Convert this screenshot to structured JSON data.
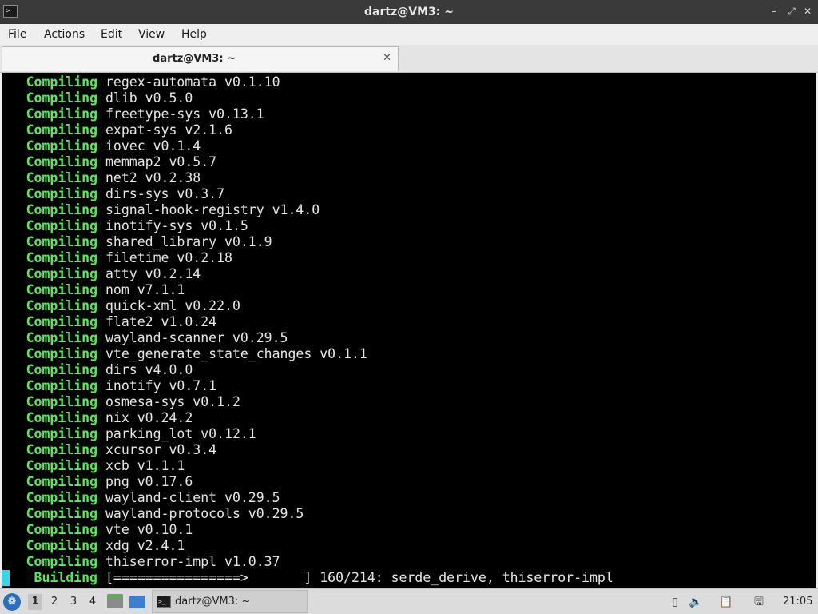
{
  "window": {
    "title": "dartz@VM3: ~",
    "icon": "terminal-icon",
    "controls": [
      "minimize-icon",
      "maximize-icon",
      "close-icon"
    ]
  },
  "menu": {
    "items": [
      "File",
      "Actions",
      "Edit",
      "View",
      "Help"
    ]
  },
  "tabs": [
    {
      "label": "dartz@VM3: ~",
      "close_icon": "close-icon"
    }
  ],
  "terminal": {
    "colors": {
      "keyword": "#55ec55",
      "text": "#e6e6e6",
      "background": "#000000",
      "cursor": "#39d5e0"
    },
    "lines": [
      {
        "keyword": "Compiling",
        "text": "regex-automata v0.1.10"
      },
      {
        "keyword": "Compiling",
        "text": "dlib v0.5.0"
      },
      {
        "keyword": "Compiling",
        "text": "freetype-sys v0.13.1"
      },
      {
        "keyword": "Compiling",
        "text": "expat-sys v2.1.6"
      },
      {
        "keyword": "Compiling",
        "text": "iovec v0.1.4"
      },
      {
        "keyword": "Compiling",
        "text": "memmap2 v0.5.7"
      },
      {
        "keyword": "Compiling",
        "text": "net2 v0.2.38"
      },
      {
        "keyword": "Compiling",
        "text": "dirs-sys v0.3.7"
      },
      {
        "keyword": "Compiling",
        "text": "signal-hook-registry v1.4.0"
      },
      {
        "keyword": "Compiling",
        "text": "inotify-sys v0.1.5"
      },
      {
        "keyword": "Compiling",
        "text": "shared_library v0.1.9"
      },
      {
        "keyword": "Compiling",
        "text": "filetime v0.2.18"
      },
      {
        "keyword": "Compiling",
        "text": "atty v0.2.14"
      },
      {
        "keyword": "Compiling",
        "text": "nom v7.1.1"
      },
      {
        "keyword": "Compiling",
        "text": "quick-xml v0.22.0"
      },
      {
        "keyword": "Compiling",
        "text": "flate2 v1.0.24"
      },
      {
        "keyword": "Compiling",
        "text": "wayland-scanner v0.29.5"
      },
      {
        "keyword": "Compiling",
        "text": "vte_generate_state_changes v0.1.1"
      },
      {
        "keyword": "Compiling",
        "text": "dirs v4.0.0"
      },
      {
        "keyword": "Compiling",
        "text": "inotify v0.7.1"
      },
      {
        "keyword": "Compiling",
        "text": "osmesa-sys v0.1.2"
      },
      {
        "keyword": "Compiling",
        "text": "nix v0.24.2"
      },
      {
        "keyword": "Compiling",
        "text": "parking_lot v0.12.1"
      },
      {
        "keyword": "Compiling",
        "text": "xcursor v0.3.4"
      },
      {
        "keyword": "Compiling",
        "text": "xcb v1.1.1"
      },
      {
        "keyword": "Compiling",
        "text": "png v0.17.6"
      },
      {
        "keyword": "Compiling",
        "text": "wayland-client v0.29.5"
      },
      {
        "keyword": "Compiling",
        "text": "wayland-protocols v0.29.5"
      },
      {
        "keyword": "Compiling",
        "text": "vte v0.10.1"
      },
      {
        "keyword": "Compiling",
        "text": "xdg v2.4.1"
      },
      {
        "keyword": "Compiling",
        "text": "thiserror-impl v1.0.37"
      }
    ],
    "status_line": {
      "keyword": "Building",
      "progress_bar": "[================>       ]",
      "progress": "160/214: serde_derive, thiserror-impl"
    }
  },
  "taskbar": {
    "menu_icon": "start-menu-icon",
    "desktops": [
      "1",
      "2",
      "3",
      "4"
    ],
    "active_desktop": "1",
    "launchers": [
      "file-manager-icon",
      "show-desktop-icon"
    ],
    "task": {
      "label": "dartz@VM3: ~",
      "icon": "terminal-icon"
    },
    "tray": [
      "clipboard-icon",
      "volume-icon",
      "notes-icon",
      "network-icon"
    ],
    "clock": "21:05"
  }
}
